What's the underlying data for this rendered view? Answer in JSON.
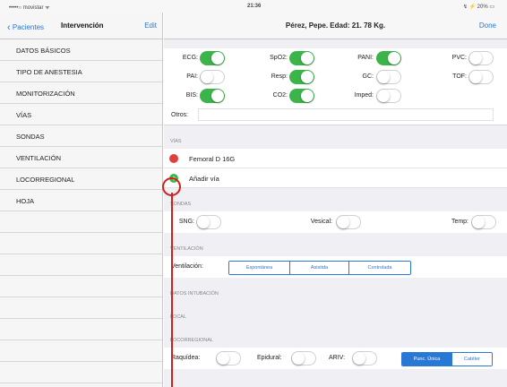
{
  "status": {
    "carrier": "•••••○ movistar ᯤ",
    "time": "21:36",
    "battery": "↯ ⚡ 20% ▭"
  },
  "sidebar": {
    "back_label": "Pacientes",
    "title": "Intervención",
    "edit_label": "Edit",
    "items": [
      "DATOS BÁSICOS",
      "TIPO DE ANESTESIA",
      "MONITORIZACIÓN",
      "VÍAS",
      "SONDAS",
      "VENTILACIÓN",
      "LOCORREGIONAL",
      "HOJA"
    ]
  },
  "nav": {
    "title": "Pérez, Pepe. Edad: 21. 78 Kg.",
    "done_label": "Done"
  },
  "monitor": {
    "ecg": {
      "label": "ECG:",
      "on": true
    },
    "spo2": {
      "label": "SpO2:",
      "on": true
    },
    "pani": {
      "label": "PANI:",
      "on": true
    },
    "pvc": {
      "label": "PVC:",
      "on": false
    },
    "pai": {
      "label": "PAI:",
      "on": false
    },
    "resp": {
      "label": "Resp:",
      "on": true
    },
    "gc": {
      "label": "GC:",
      "on": false
    },
    "tof": {
      "label": "TOF:",
      "on": false
    },
    "bis": {
      "label": "BIS:",
      "on": true
    },
    "co2": {
      "label": "CO2:",
      "on": true
    },
    "imped": {
      "label": "Imped:",
      "on": false
    },
    "otros_label": "Otros:",
    "otros_value": ""
  },
  "vias": {
    "header": "VÍAS",
    "items": [
      "Femoral D 16G"
    ],
    "add_label": "Añadir vía"
  },
  "sondas": {
    "header": "SONDAS",
    "sng": {
      "label": "SNG:",
      "on": false
    },
    "vesical": {
      "label": "Vesical:",
      "on": false
    },
    "temp": {
      "label": "Temp:",
      "on": false
    }
  },
  "ventilacion": {
    "header": "VENTILACIÓN",
    "label": "Ventilación:",
    "options": [
      "Espontánea",
      "Asistida",
      "Controlada"
    ]
  },
  "intubacion": {
    "header": "DATOS INTUBACIÓN"
  },
  "local": {
    "header": "LOCAL"
  },
  "locorregional": {
    "header": "LOCORREGIONAL",
    "raquidea": {
      "label": "Raquídea:",
      "on": false
    },
    "epidural": {
      "label": "Epidural:",
      "on": false
    },
    "ariv": {
      "label": "ARIV:",
      "on": false
    },
    "punc_options": [
      "Punc. Única",
      "Catéter"
    ],
    "punc_selected": 0
  }
}
